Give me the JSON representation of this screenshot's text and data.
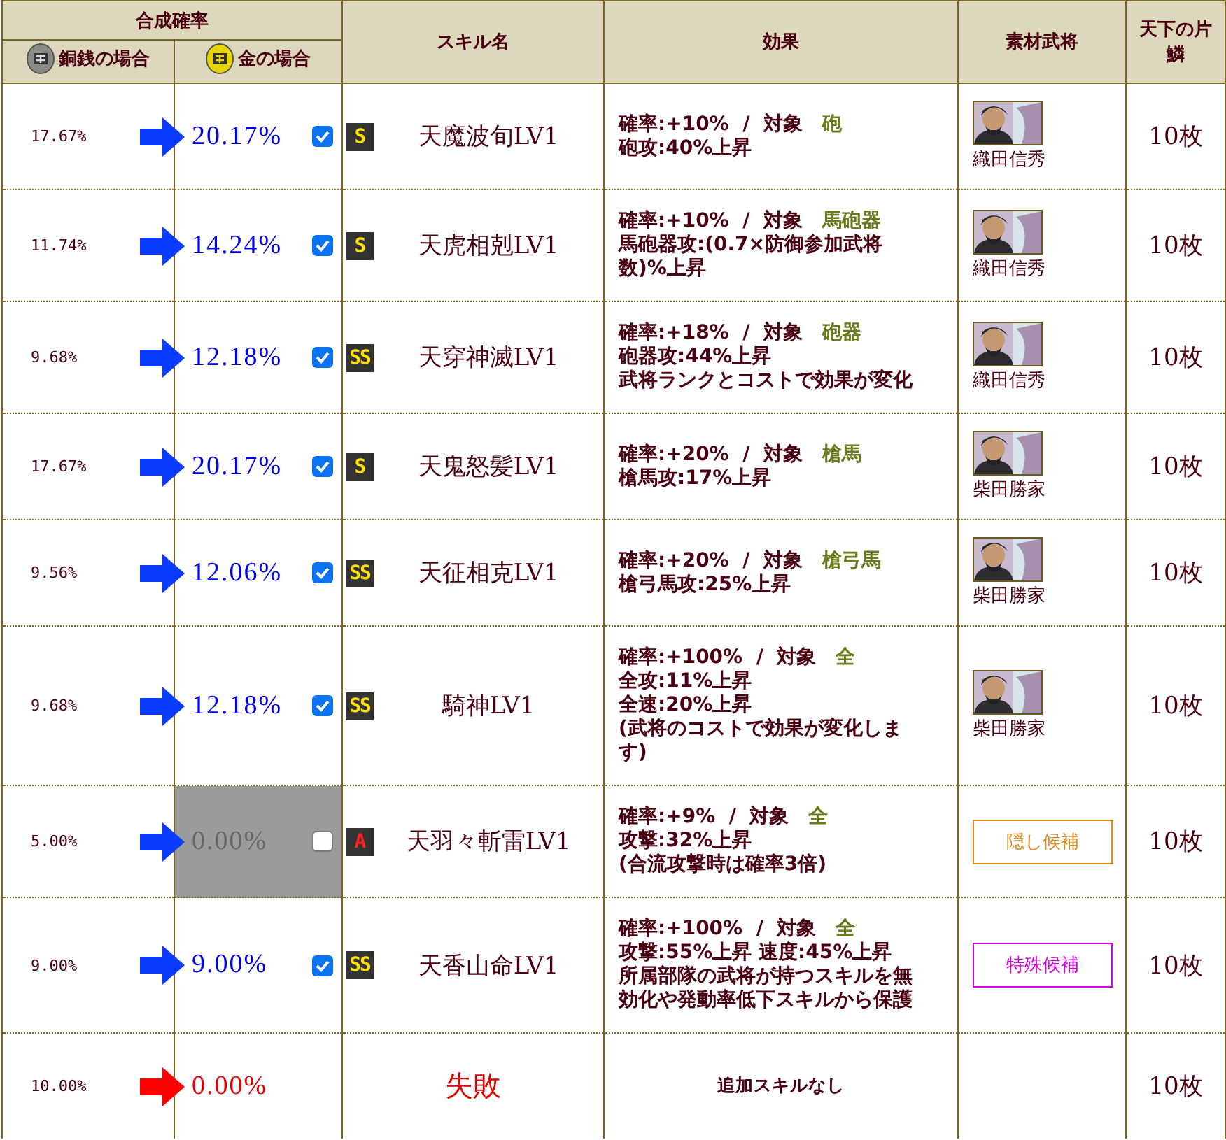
{
  "header": {
    "rate_group": "合成確率",
    "copper": "銅銭の場合",
    "gold": "金の場合",
    "skill_name": "スキル名",
    "effect": "効果",
    "material": "素材武将",
    "shards": "天下の片鱗"
  },
  "rows": [
    {
      "kind": "skill",
      "copper_rate": "17.67%",
      "gold_rate": "20.17%",
      "checked": true,
      "rank": {
        "label": "S",
        "kind": "high"
      },
      "name": "天魔波旬LV1",
      "effect_head": "確率:+10%  /  対象",
      "target": "砲",
      "effect_lines": [
        "砲攻:40%上昇"
      ],
      "material": {
        "kind": "general",
        "name": "織田信秀"
      },
      "shards": "10枚"
    },
    {
      "kind": "skill",
      "copper_rate": "11.74%",
      "gold_rate": "14.24%",
      "checked": true,
      "rank": {
        "label": "S",
        "kind": "high"
      },
      "name": "天虎相剋LV1",
      "effect_head": "確率:+10%  /  対象",
      "target": "馬砲器",
      "effect_lines": [
        "馬砲器攻:(0.7×防御参加武将数)%上昇"
      ],
      "material": {
        "kind": "general",
        "name": "織田信秀"
      },
      "shards": "10枚"
    },
    {
      "kind": "skill",
      "copper_rate": "9.68%",
      "gold_rate": "12.18%",
      "checked": true,
      "rank": {
        "label": "SS",
        "kind": "high"
      },
      "name": "天穿神滅LV1",
      "effect_head": "確率:+18%  /  対象",
      "target": "砲器",
      "effect_lines": [
        "砲器攻:44%上昇",
        "武将ランクとコストで効果が変化"
      ],
      "material": {
        "kind": "general",
        "name": "織田信秀"
      },
      "shards": "10枚"
    },
    {
      "kind": "skill",
      "copper_rate": "17.67%",
      "gold_rate": "20.17%",
      "checked": true,
      "rank": {
        "label": "S",
        "kind": "high"
      },
      "name": "天鬼怒髪LV1",
      "effect_head": "確率:+20%  /  対象",
      "target": "槍馬",
      "effect_lines": [
        "槍馬攻:17%上昇"
      ],
      "material": {
        "kind": "general",
        "name": "柴田勝家"
      },
      "shards": "10枚"
    },
    {
      "kind": "skill",
      "copper_rate": "9.56%",
      "gold_rate": "12.06%",
      "checked": true,
      "rank": {
        "label": "SS",
        "kind": "high"
      },
      "name": "天征相克LV1",
      "effect_head": "確率:+20%  /  対象",
      "target": "槍弓馬",
      "effect_lines": [
        "槍弓馬攻:25%上昇"
      ],
      "material": {
        "kind": "general",
        "name": "柴田勝家"
      },
      "shards": "10枚"
    },
    {
      "kind": "skill",
      "copper_rate": "9.68%",
      "gold_rate": "12.18%",
      "checked": true,
      "rank": {
        "label": "SS",
        "kind": "high"
      },
      "name": "騎神LV1",
      "effect_head": "確率:+100%  /  対象",
      "target": "全",
      "effect_lines": [
        "全攻:11%上昇",
        "全速:20%上昇",
        "(武将のコストで効果が変化します)"
      ],
      "material": {
        "kind": "general",
        "name": "柴田勝家"
      },
      "shards": "10枚"
    },
    {
      "kind": "skill",
      "copper_rate": "5.00%",
      "gold_rate": "0.00%",
      "checked": false,
      "rank": {
        "label": "A",
        "kind": "low"
      },
      "name": "天羽々斬雷LV1",
      "effect_head": "確率:+9%  /  対象",
      "target": "全",
      "effect_lines": [
        "攻撃:32%上昇",
        "(合流攻撃時は確率3倍)"
      ],
      "material": {
        "kind": "tag",
        "label": "隠し候補",
        "color": "#e08a20"
      },
      "shards": "10枚"
    },
    {
      "kind": "skill",
      "copper_rate": "9.00%",
      "gold_rate": "9.00%",
      "checked": true,
      "rank": {
        "label": "SS",
        "kind": "high"
      },
      "name": "天香山命LV1",
      "effect_head": "確率:+100%  /  対象",
      "target": "全",
      "effect_lines": [
        "攻撃:55%上昇  速度:45%上昇",
        "所属部隊の武将が持つスキルを無効化や発動率低下スキルから保護"
      ],
      "material": {
        "kind": "tag",
        "label": "特殊候補",
        "color": "#d000e0"
      },
      "shards": "10枚"
    },
    {
      "kind": "fail",
      "copper_rate": "10.00%",
      "gold_rate": "0.00%",
      "name": "失敗",
      "effect_note": "追加スキルなし",
      "shards": "10枚"
    }
  ]
}
